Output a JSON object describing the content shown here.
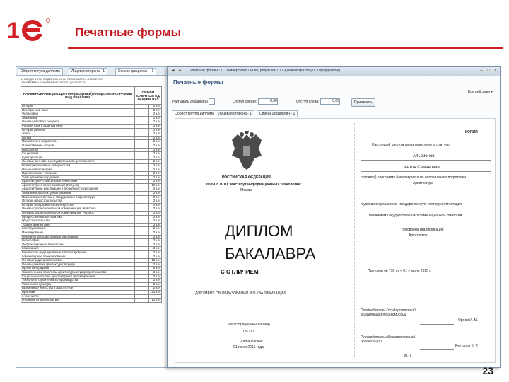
{
  "slide": {
    "title": "Печатные формы",
    "page_number": "23",
    "brand_color": "#d22027"
  },
  "back_window": {
    "tabs": [
      "Оборот титула диплома",
      "Лицевая сторона - 1",
      "Список дисциплин - 1"
    ],
    "heading_lines": [
      "3. СВЕДЕНИЯ О СОДЕРЖАНИИ И РЕЗУЛЬТАТАХ ОСВОЕНИЯ",
      "ПРОГРАММЫ БАКАЛАВРИАТА/СПЕЦИАЛИТЕТА"
    ],
    "col_name": "НАИМЕНОВАНИЕ ДИСЦИПЛИН (МОДУЛЕЙ)/РАЗДЕЛЫ ПРОГРАММЫ ВИД ПРАКТИКИ",
    "col_units": "ОБЪЕМ ЗАЧЕТНЫХ ЕД/ АКАДЕМ ЧАС",
    "rows": [
      {
        "name": "История",
        "hours": "2 з.е."
      },
      {
        "name": "Иностранный язык",
        "hours": "2 з.е."
      },
      {
        "name": "Философия",
        "hours": "2 з.е."
      },
      {
        "name": "Экономика",
        "hours": "2 з.е."
      },
      {
        "name": "Основы делового общения",
        "hours": "2 з.е."
      },
      {
        "name": "Русский язык и культура речи",
        "hours": "2 з.е."
      },
      {
        "name": "История религий",
        "hours": "2 з.е."
      },
      {
        "name": "Этика",
        "hours": "2 з.е."
      },
      {
        "name": "Логика",
        "hours": "2 з.е."
      },
      {
        "name": "Психология и педагогика",
        "hours": "2 з.е."
      },
      {
        "name": "Отечественная история",
        "hours": "2 з.е."
      },
      {
        "name": "Психология",
        "hours": "2 з.е."
      },
      {
        "name": "Социология",
        "hours": "2 з.е."
      },
      {
        "name": "Культурология",
        "hours": "2 з.е."
      },
      {
        "name": "Основы научной и исследовательской деятельности",
        "hours": "2 з.е."
      },
      {
        "name": "Геометрия основных поверхностей",
        "hours": "2 з.е."
      },
      {
        "name": "Начальная геометрия",
        "hours": "2 з.е."
      },
      {
        "name": "Перспективное черчение",
        "hours": "2 з.е."
      },
      {
        "name": "Типы зданий и сооружений",
        "hours": "2 з.е."
      },
      {
        "name": "Архитектурно-строительные технологии",
        "hours": "2 з.е."
      },
      {
        "name": "Архитектурное проектирование (Рисунок)",
        "hours": "20 з.е."
      },
      {
        "name": "Архитектурные конструкции и теория конструирования",
        "hours": "2 з.е."
      },
      {
        "name": "Экономика архитектурных решений",
        "hours": "2 з.е."
      },
      {
        "name": "Инженерные системы и оборудование в архитектуре",
        "hours": "2 з.е."
      },
      {
        "name": "История градостроительства",
        "hours": "2 з.е."
      },
      {
        "name": "История изобразительного искусства",
        "hours": "2 з.е."
      },
      {
        "name": "Основы профессиональной коммуникации: Живопись",
        "hours": "2 з.е."
      },
      {
        "name": "Основы профессиональной коммуникации: Рисунок",
        "hours": "2 з.е."
      },
      {
        "name": "Профессиональная практика",
        "hours": "2 з.е."
      },
      {
        "name": "Градостроительство",
        "hours": "2 з.е."
      },
      {
        "name": "Теория архитектуры",
        "hours": "2 з.е."
      },
      {
        "name": "Конструирование",
        "hours": "2 з.е."
      },
      {
        "name": "Макетирование",
        "hours": "2 з.е."
      },
      {
        "name": "Объемно-пространственная композиция",
        "hours": "2 з.е."
      },
      {
        "name": "Фотография",
        "hours": "2 з.е."
      },
      {
        "name": "Информационные технологии",
        "hours": "2 з.е."
      },
      {
        "name": "Композиция",
        "hours": "2 з.е."
      },
      {
        "name": "Вариантное моделирование в проектировании",
        "hours": "2 з.е."
      },
      {
        "name": "Компьютерное проектирование",
        "hours": "2 з.е."
      },
      {
        "name": "Основы градостроительства",
        "hours": "12 з.е."
      },
      {
        "name": "Основы дизайна архитектурной среды",
        "hours": "2 з.е."
      },
      {
        "name": "Проектная графика",
        "hours": "6 з.е."
      },
      {
        "name": "Экологические проблемы архитектуры и градостроительства",
        "hours": "2 з.е."
      },
      {
        "name": "Социальные основы архитектурного проектирования",
        "hours": "2 з.е."
      },
      {
        "name": "Технология строительного производства",
        "hours": "2 з.е."
      },
      {
        "name": "Физическая культура",
        "hours": "2 з.е."
      },
      {
        "name": "Визуальные искусства в архитектуре",
        "hours": "2 з.е."
      },
      {
        "name": "Практики",
        "hours": "124 з.е."
      },
      {
        "name": "в том числе:",
        "hours": ""
      },
      {
        "name": "Ознакомительная практика",
        "hours": "12 з.е."
      }
    ]
  },
  "front_window": {
    "title": "Печатные формы : 1С:Университет ПРОФ, редакция 2.1 / Администратор (1С:Предприятие)",
    "header": "Печатные формы",
    "all_actions": "Все действия ▾",
    "toolbar": {
      "checkbox_label": "Учитывать дубликаты",
      "margin_top_label": "Отступ сверху:",
      "margin_top_value": "0,00",
      "margin_left_label": "Отступ слева:",
      "margin_left_value": "0,00",
      "apply_label": "Применить"
    },
    "tabs": [
      "Оборот титула диплома",
      "Лицевая сторона - 1",
      "Список дисциплин - 1"
    ],
    "diploma": {
      "country": "РОССИЙСКАЯ ФЕДЕРАЦИЯ",
      "institution": "ФГБОУ ВПО \"Институт информационных технологий\"",
      "city": "Москва",
      "word1": "ДИПЛОМ",
      "word2": "БАКАЛАВРА",
      "honors": "С ОТЛИЧИЕМ",
      "doc_type": "ДОКУМЕНТ ОБ ОБРАЗОВАНИИ И О КВАЛИФИКАЦИИ",
      "reg_label": "Регистрационный номер",
      "reg_value": "05-777",
      "date_label": "Дата выдачи",
      "date_value": "01 июня 2015 года",
      "copy": "КОПИЯ",
      "certify": "Настоящий диплом свидетельствует о том, что",
      "surname": "Альбионов",
      "given_name": "Антон Семенович",
      "mastered": "освоил(а) программу бакалавриата по направлению подготовки",
      "program": "Архитектура",
      "passed": "и успешно прошел(ла) государственную итоговую аттестацию",
      "decision": "Решением Государственной экзаменационной комиссии",
      "qualification_label": "присвоена квалификация",
      "qualification": "Архитектор",
      "protocol": "Протокол № 735 от « 01 » июня 2015 г.",
      "chair_label": "Председатель Государственной экзаменационной комиссии",
      "chair_name": "Орлов И. М.",
      "rector_label": "Руководитель образовательной организации",
      "rector_name": "Ректоров К. Р.",
      "stamp": "М.П."
    }
  }
}
